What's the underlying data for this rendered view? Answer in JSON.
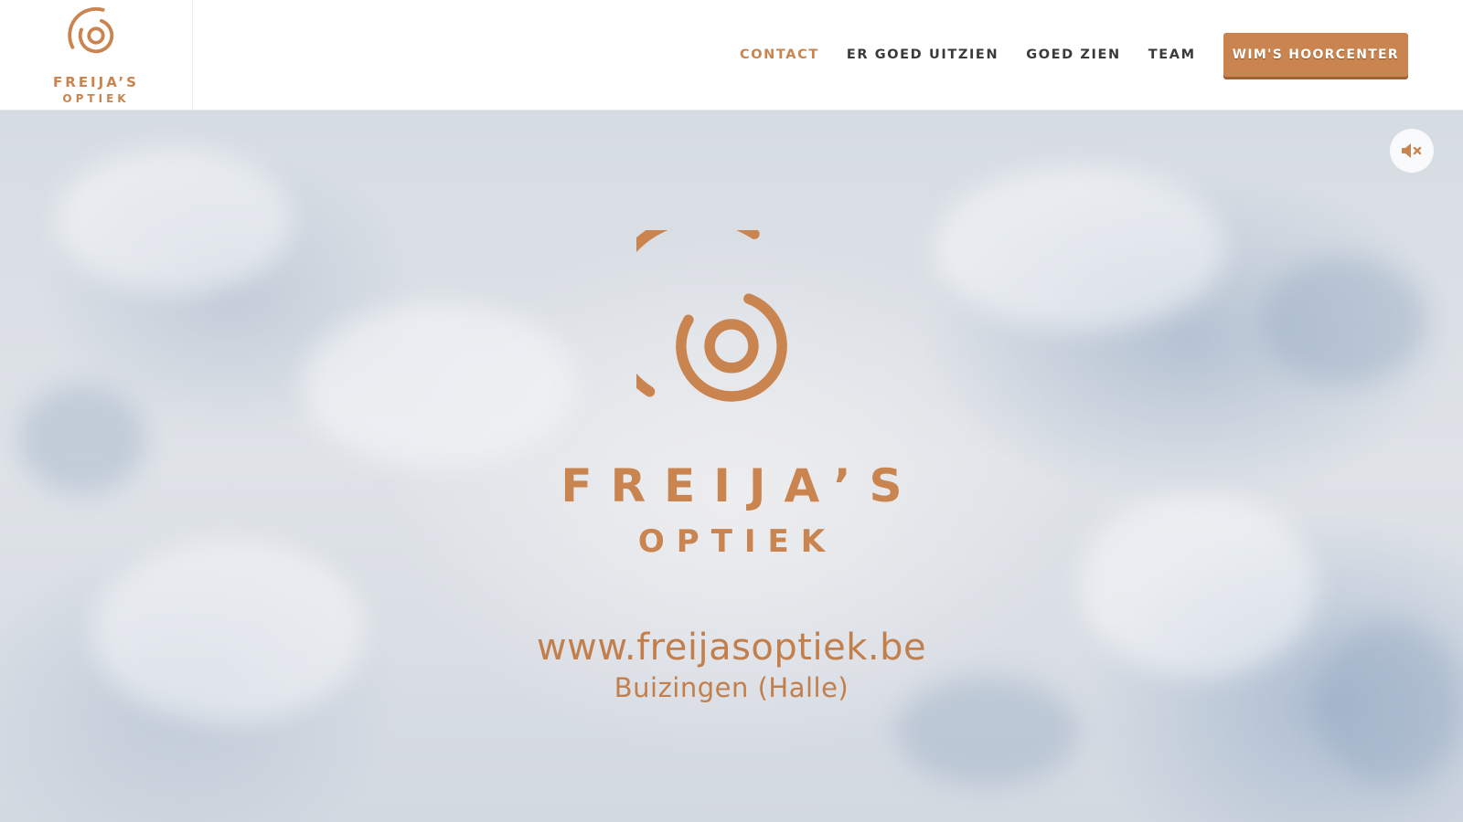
{
  "brand": {
    "name_line1": "FREIJA’S",
    "name_line2": "OPTIEK",
    "accent_color": "#c9844f"
  },
  "nav": {
    "items": [
      {
        "label": "CONTACT",
        "active": true
      },
      {
        "label": "ER GOED UITZIEN",
        "active": false
      },
      {
        "label": "GOED ZIEN",
        "active": false
      },
      {
        "label": "TEAM",
        "active": false
      }
    ],
    "cta_label": "WIM'S HOORCENTER"
  },
  "hero": {
    "title_line1": "FREIJA’S",
    "title_line2": "OPTIEK",
    "website": "www.freijasoptiek.be",
    "location": "Buizingen (Halle)",
    "mute_icon": "speaker-muted-icon"
  }
}
